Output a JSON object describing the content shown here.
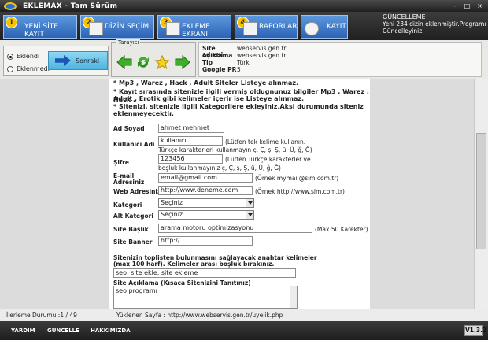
{
  "window": {
    "title": "EKLEMAX - Tam Sürüm",
    "controls": [
      "–",
      "□",
      "×"
    ]
  },
  "toolbar": {
    "buttons": [
      {
        "num": "1",
        "label": "YENİ SİTE KAYIT"
      },
      {
        "num": "2",
        "label": "DİZİN SEÇİMİ"
      },
      {
        "num": "3",
        "label": "EKLEME EKRANI"
      },
      {
        "num": "4",
        "label": "RAPORLAR"
      },
      {
        "num": "",
        "label": "KAYIT"
      }
    ],
    "update": {
      "heading": "GÜNCELLEME",
      "line1": "Yeni 234 dizin eklenmiştir.Programı",
      "line2": "Güncelleyiniz."
    }
  },
  "mode": {
    "option1": "Eklendi",
    "option2": "Eklenmedi",
    "selected": "Eklendi",
    "next_label": "Sonraki"
  },
  "browser": {
    "legend": "Tarayıcı"
  },
  "site_info": {
    "rows": [
      {
        "key": "Site adresi",
        "value": "webservis.gen.tr"
      },
      {
        "key": "Açıklama",
        "value": "webservis.gen.tr"
      },
      {
        "key": "Tip",
        "value": "Türk"
      },
      {
        "key": "Google PR",
        "value": "5"
      }
    ]
  },
  "form": {
    "warnings": [
      "* Mp3 , Warez , Hack , Adult Siteler Listeye alınmaz.",
      "* Kayıt sırasında sitenizle ilgili vermiş oldugnunuz bilgiler Mp3 , Warez , Hack ,",
      "Adult , Erotik gibi kelimeler içerir ise Listeye alınmaz.",
      "* Sitenizi, sitenizle ilgili Kategorilere ekleyiniz.Aksi durumunda siteniz",
      "eklenmeyecektir."
    ],
    "name_label": "Ad Soyad",
    "name_value": "ahmet mehmet",
    "user_label": "Kullanıcı Adı",
    "user_value": "kullanıcı",
    "user_hint1": "(Lütfen tek kelime kullanın.",
    "user_hint2": "Türkçe karakterleri kullanmayın ç, Ç, ş, Ş, ü, Ü, ğ, Ğ)",
    "pass_label": "Şifre",
    "pass_value": "123456",
    "pass_hint1": "(Lütfen Türkçe karakterler ve",
    "pass_hint2": "boşluk kullanmayınız ç, Ç, ş, Ş, ü, Ü, ğ, Ğ)",
    "email_label1": "E-mail",
    "email_label2": "Adresiniz",
    "email_value": "email@gmail.com",
    "email_hint": "(Örnek mymail@sim.com.tr)",
    "web_label": "Web Adresiniz",
    "web_value": "http://www.deneme.com",
    "web_hint": "(Örnek http://www.sim.com.tr)",
    "cat_label": "Kategori",
    "cat_value": "Seçiniz",
    "subcat_label": "Alt Kategori",
    "subcat_value": "Seçiniz",
    "title_label": "Site Başlık",
    "title_value": "arama motoru optimizasyonu",
    "title_hint": "(Max 50 Karekter)",
    "banner_label": "Site Banner",
    "banner_value": "http://",
    "keywords_label1": "Sitenizin toplisten bulunmasını sağlayacak anahtar kelimeler",
    "keywords_label2": "(max 100 harf). Kelimeler arası boşluk bırakınız.",
    "keywords_value": "seo, site ekle, site ekleme",
    "desc_label": "Site Açıklama (Kısaca Sitenizini Tanıtınız)",
    "desc_value": "seo programı"
  },
  "status": {
    "progress_label": "İlerleme Durumu :1 / 49",
    "loaded_label": "Yüklenen Sayfa : http://www.webservis.gen.tr/uyelik.php"
  },
  "bottom": {
    "help": "YARDIM",
    "update": "GÜNCELLE",
    "about": "HAKKIMIZDA",
    "version": "V1.3.2"
  }
}
